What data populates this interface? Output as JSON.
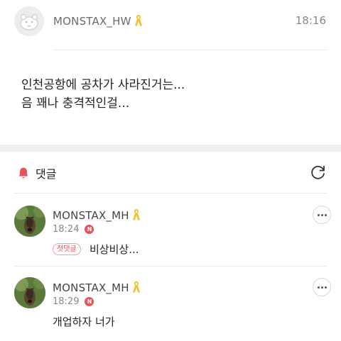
{
  "post": {
    "author": "MONSTAX_HW",
    "time": "18:16",
    "body_line1": "인천공항에 공차가 사라진거는...",
    "body_line2": "음 꽤나 충격적인걸..."
  },
  "comments_section": {
    "title": "댓글",
    "items": [
      {
        "author": "MONSTAX_MH",
        "time": "18:24",
        "new_badge": "N",
        "first_badge": "첫댓글",
        "text": "비상비상..."
      },
      {
        "author": "MONSTAX_MH",
        "time": "18:29",
        "new_badge": "N",
        "text": "개업하자 너가"
      }
    ]
  },
  "colors": {
    "accent_red": "#e8535a",
    "ribbon_yellow": "#f2c230"
  },
  "icons": [
    "default-avatar-icon",
    "yellow-ribbon-icon",
    "bell-icon",
    "refresh-icon",
    "more-options-icon"
  ]
}
